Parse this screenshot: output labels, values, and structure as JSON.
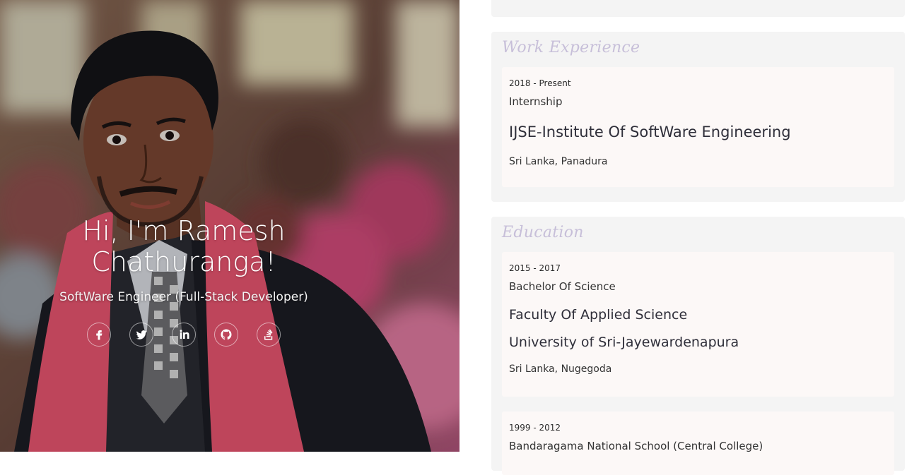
{
  "hero": {
    "title": "Hi, I'm Ramesh Chathuranga!",
    "subtitle": "SoftWare Engineer (Full-Stack Developer)",
    "socials": [
      {
        "name": "facebook-icon"
      },
      {
        "name": "twitter-icon"
      },
      {
        "name": "linkedin-icon"
      },
      {
        "name": "github-icon"
      },
      {
        "name": "stackoverflow-icon"
      }
    ]
  },
  "work": {
    "title": "Work Experience",
    "items": [
      {
        "period": "2018 - Present",
        "role": "Internship",
        "org": "IJSE-Institute Of SoftWare Engineering",
        "location": "Sri Lanka, Panadura"
      }
    ]
  },
  "education": {
    "title": "Education",
    "items": [
      {
        "period": "2015 - 2017",
        "degree": "Bachelor Of Science",
        "faculty": "Faculty Of Applied Science",
        "institution": "University of Sri-Jayewardenapura",
        "location": "Sri Lanka, Nugegoda"
      },
      {
        "period": "1999 - 2012",
        "institution": "Bandaragama National School (Central College)"
      }
    ]
  }
}
